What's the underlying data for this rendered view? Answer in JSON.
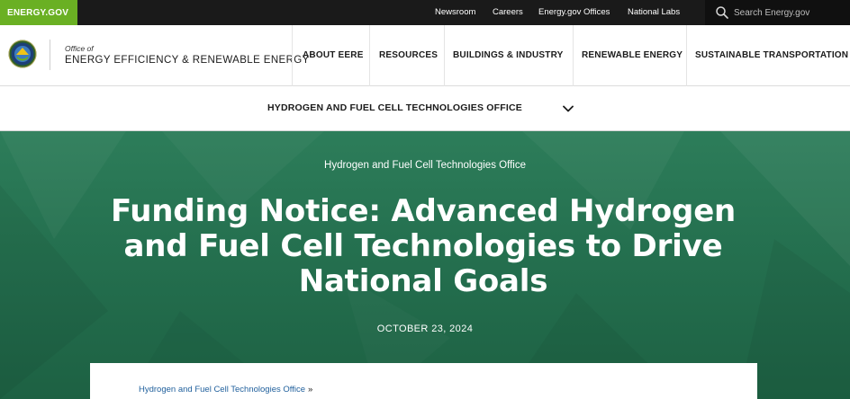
{
  "brand": {
    "label": "ENERGY.GOV",
    "color": "#6ab023"
  },
  "utility_nav": {
    "links": [
      "Newsroom",
      "Careers",
      "Energy.gov Offices",
      "National Labs"
    ],
    "search": {
      "placeholder": "Search Energy.gov",
      "icon": "search-icon"
    }
  },
  "header": {
    "office_of": "Office of",
    "office_name": "ENERGY EFFICIENCY & RENEWABLE ENERGY",
    "logo_icon": "doe-seal-icon",
    "nav": [
      "ABOUT EERE",
      "RESOURCES",
      "BUILDINGS & INDUSTRY",
      "RENEWABLE ENERGY",
      "SUSTAINABLE TRANSPORTATION"
    ]
  },
  "subnav": {
    "label": "HYDROGEN AND FUEL CELL TECHNOLOGIES OFFICE",
    "icon": "chevron-down-icon"
  },
  "hero": {
    "eyebrow": "Hydrogen and Fuel Cell Technologies Office",
    "title": "Funding Notice: Advanced Hydrogen and Fuel Cell Technologies to Drive National Goals",
    "date": "OCTOBER 23, 2024",
    "background_color": "#257150"
  },
  "breadcrumb": {
    "label": "Hydrogen and Fuel Cell Technologies Office",
    "separator": "»"
  }
}
